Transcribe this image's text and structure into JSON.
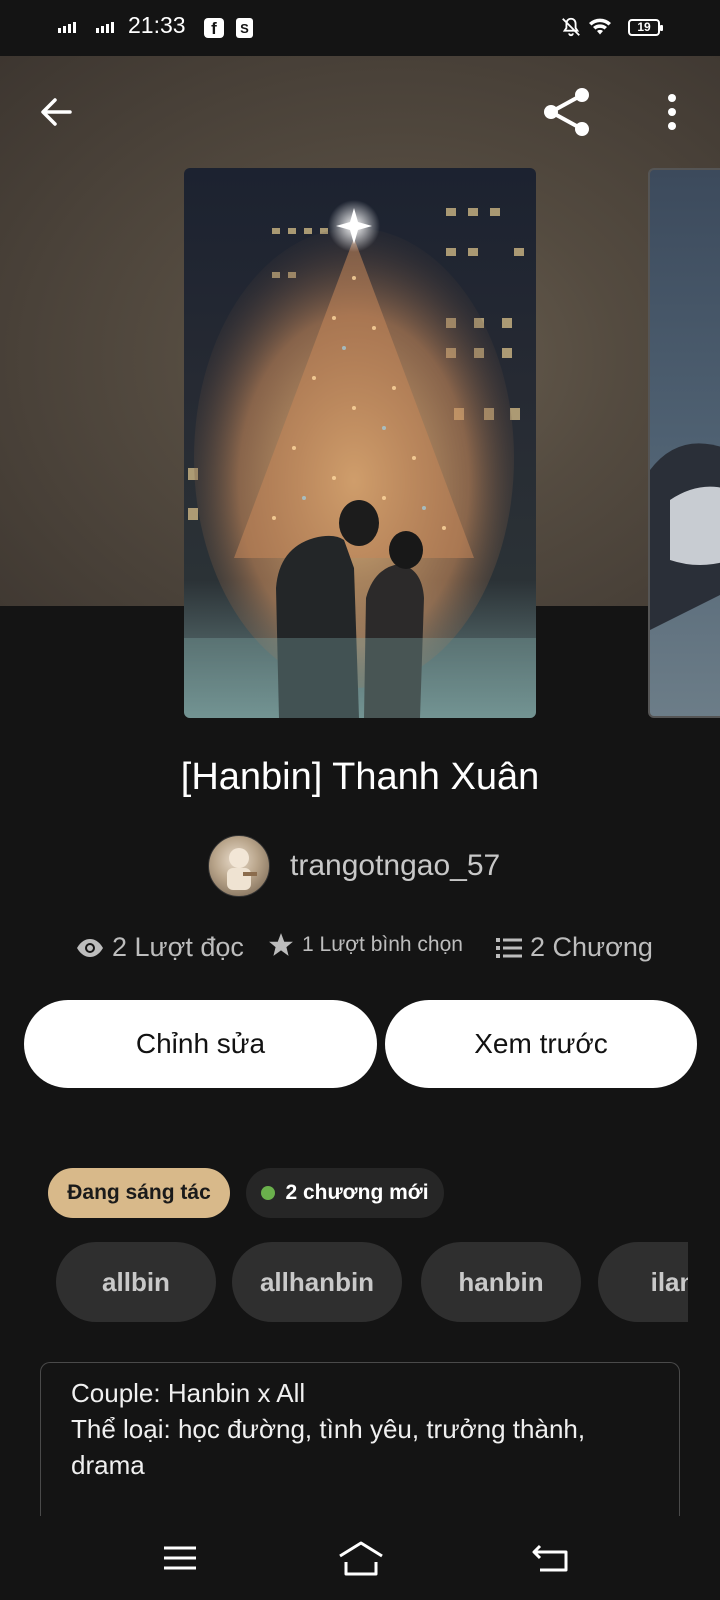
{
  "status_bar": {
    "time": "21:33",
    "battery": "19",
    "icons": [
      "signal-icon",
      "signal-icon",
      "facebook-icon",
      "shopee-icon",
      "bell-off-icon",
      "wifi-icon",
      "battery-icon"
    ]
  },
  "header": {
    "icons": [
      "arrow-left-icon",
      "share-icon",
      "more-vertical-icon"
    ]
  },
  "story": {
    "title": "[Hanbin] Thanh Xuân",
    "author": "trangotngao_57"
  },
  "stats": {
    "reads": "2 Lượt đọc",
    "votes": "1 Lượt bình chọn",
    "chapters": "2 Chương"
  },
  "actions": {
    "edit": "Chỉnh sửa",
    "preview": "Xem trước"
  },
  "badges": {
    "status": "Đang sáng tác",
    "new_chapters": "2 chương mới"
  },
  "tags": [
    "allbin",
    "allhanbin",
    "hanbin",
    "ilan"
  ],
  "description": {
    "line1": "Couple: Hanbin x All",
    "line2": "Thể loại: học đường, tình yêu, trưởng thành, drama"
  },
  "nav_bar": {
    "icons": [
      "menu-icon",
      "home-icon",
      "back-nav-icon"
    ]
  }
}
